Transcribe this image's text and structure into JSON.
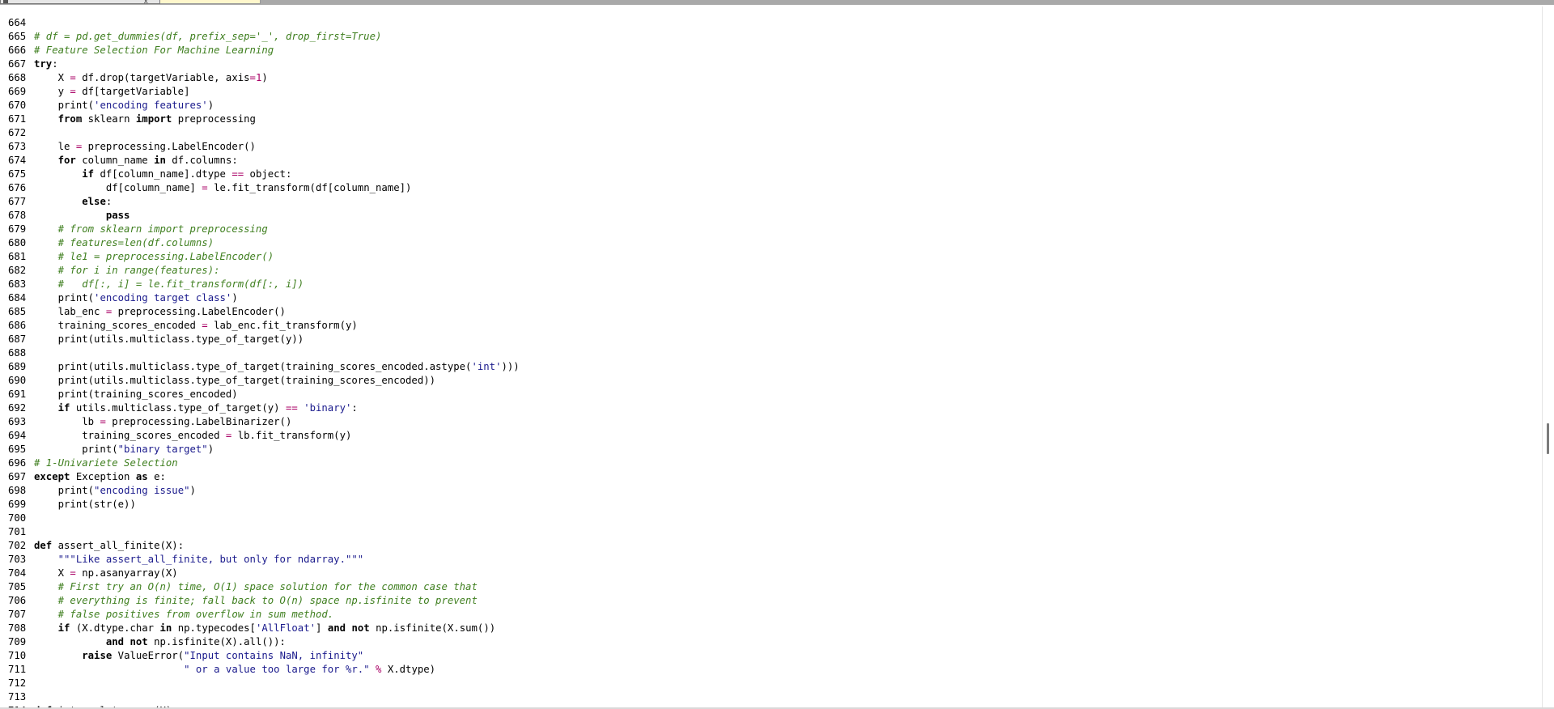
{
  "tabs": [
    {
      "label": "",
      "close": "x",
      "active": false
    },
    {
      "label": "",
      "close": "",
      "active": true
    }
  ],
  "scrollbar": {
    "position": 0.62
  },
  "colors": {
    "comment": "#3f7f1f",
    "string": "#1a1a8c",
    "operator": "#aa0066",
    "keyword": "#000000",
    "background": "#ffffff"
  },
  "editor": {
    "lines": [
      {
        "n": "664",
        "t": []
      },
      {
        "n": "665",
        "t": [
          [
            "c",
            "# df = pd.get_dummies(df, prefix_sep='_', drop_first=True)"
          ]
        ]
      },
      {
        "n": "666",
        "t": [
          [
            "c",
            "# Feature Selection For Machine Learning"
          ]
        ]
      },
      {
        "n": "667",
        "t": [
          [
            "k",
            "try"
          ],
          [
            "t",
            ":"
          ]
        ]
      },
      {
        "n": "668",
        "t": [
          [
            "t",
            "    X "
          ],
          [
            "o",
            "="
          ],
          [
            "t",
            " df.drop(targetVariable, axis"
          ],
          [
            "o",
            "="
          ],
          [
            "o",
            "1"
          ],
          [
            "t",
            ")"
          ]
        ]
      },
      {
        "n": "669",
        "t": [
          [
            "t",
            "    y "
          ],
          [
            "o",
            "="
          ],
          [
            "t",
            " df[targetVariable]"
          ]
        ]
      },
      {
        "n": "670",
        "t": [
          [
            "t",
            "    print("
          ],
          [
            "s",
            "'encoding features'"
          ],
          [
            "t",
            ")"
          ]
        ]
      },
      {
        "n": "671",
        "t": [
          [
            "t",
            "    "
          ],
          [
            "k",
            "from"
          ],
          [
            "t",
            " sklearn "
          ],
          [
            "k",
            "import"
          ],
          [
            "t",
            " preprocessing"
          ]
        ]
      },
      {
        "n": "672",
        "t": []
      },
      {
        "n": "673",
        "t": [
          [
            "t",
            "    le "
          ],
          [
            "o",
            "="
          ],
          [
            "t",
            " preprocessing.LabelEncoder()"
          ]
        ]
      },
      {
        "n": "674",
        "t": [
          [
            "t",
            "    "
          ],
          [
            "k",
            "for"
          ],
          [
            "t",
            " column_name "
          ],
          [
            "k",
            "in"
          ],
          [
            "t",
            " df.columns:"
          ]
        ]
      },
      {
        "n": "675",
        "t": [
          [
            "t",
            "        "
          ],
          [
            "k",
            "if"
          ],
          [
            "t",
            " df[column_name].dtype "
          ],
          [
            "o",
            "=="
          ],
          [
            "t",
            " object:"
          ]
        ]
      },
      {
        "n": "676",
        "t": [
          [
            "t",
            "            df[column_name] "
          ],
          [
            "o",
            "="
          ],
          [
            "t",
            " le.fit_transform(df[column_name])"
          ]
        ]
      },
      {
        "n": "677",
        "t": [
          [
            "t",
            "        "
          ],
          [
            "k",
            "else"
          ],
          [
            "t",
            ":"
          ]
        ]
      },
      {
        "n": "678",
        "t": [
          [
            "t",
            "            "
          ],
          [
            "k",
            "pass"
          ]
        ]
      },
      {
        "n": "679",
        "t": [
          [
            "t",
            "    "
          ],
          [
            "c",
            "# from sklearn import preprocessing"
          ]
        ]
      },
      {
        "n": "680",
        "t": [
          [
            "t",
            "    "
          ],
          [
            "c",
            "# features=len(df.columns)"
          ]
        ]
      },
      {
        "n": "681",
        "t": [
          [
            "t",
            "    "
          ],
          [
            "c",
            "# le1 = preprocessing.LabelEncoder()"
          ]
        ]
      },
      {
        "n": "682",
        "t": [
          [
            "t",
            "    "
          ],
          [
            "c",
            "# for i in range(features):"
          ]
        ]
      },
      {
        "n": "683",
        "t": [
          [
            "t",
            "    "
          ],
          [
            "c",
            "#   df[:, i] = le.fit_transform(df[:, i])"
          ]
        ]
      },
      {
        "n": "684",
        "t": [
          [
            "t",
            "    print("
          ],
          [
            "s",
            "'encoding target class'"
          ],
          [
            "t",
            ")"
          ]
        ]
      },
      {
        "n": "685",
        "t": [
          [
            "t",
            "    lab_enc "
          ],
          [
            "o",
            "="
          ],
          [
            "t",
            " preprocessing.LabelEncoder()"
          ]
        ]
      },
      {
        "n": "686",
        "t": [
          [
            "t",
            "    training_scores_encoded "
          ],
          [
            "o",
            "="
          ],
          [
            "t",
            " lab_enc.fit_transform(y)"
          ]
        ]
      },
      {
        "n": "687",
        "t": [
          [
            "t",
            "    print(utils.multiclass.type_of_target(y))"
          ]
        ]
      },
      {
        "n": "688",
        "t": []
      },
      {
        "n": "689",
        "t": [
          [
            "t",
            "    print(utils.multiclass.type_of_target(training_scores_encoded.astype("
          ],
          [
            "s",
            "'int'"
          ],
          [
            "t",
            ")))"
          ]
        ]
      },
      {
        "n": "690",
        "t": [
          [
            "t",
            "    print(utils.multiclass.type_of_target(training_scores_encoded))"
          ]
        ]
      },
      {
        "n": "691",
        "t": [
          [
            "t",
            "    print(training_scores_encoded)"
          ]
        ]
      },
      {
        "n": "692",
        "t": [
          [
            "t",
            "    "
          ],
          [
            "k",
            "if"
          ],
          [
            "t",
            " utils.multiclass.type_of_target(y) "
          ],
          [
            "o",
            "=="
          ],
          [
            "t",
            " "
          ],
          [
            "s",
            "'binary'"
          ],
          [
            "t",
            ":"
          ]
        ]
      },
      {
        "n": "693",
        "t": [
          [
            "t",
            "        lb "
          ],
          [
            "o",
            "="
          ],
          [
            "t",
            " preprocessing.LabelBinarizer()"
          ]
        ]
      },
      {
        "n": "694",
        "t": [
          [
            "t",
            "        training_scores_encoded "
          ],
          [
            "o",
            "="
          ],
          [
            "t",
            " lb.fit_transform(y)"
          ]
        ]
      },
      {
        "n": "695",
        "t": [
          [
            "t",
            "        print("
          ],
          [
            "s",
            "\"binary target\""
          ],
          [
            "t",
            ")"
          ]
        ]
      },
      {
        "n": "696",
        "t": [
          [
            "c",
            "# 1-Univariete Selection"
          ]
        ]
      },
      {
        "n": "697",
        "t": [
          [
            "k",
            "except"
          ],
          [
            "t",
            " Exception "
          ],
          [
            "k",
            "as"
          ],
          [
            "t",
            " e:"
          ]
        ]
      },
      {
        "n": "698",
        "t": [
          [
            "t",
            "    print("
          ],
          [
            "s",
            "\"encoding issue\""
          ],
          [
            "t",
            ")"
          ]
        ]
      },
      {
        "n": "699",
        "t": [
          [
            "t",
            "    print(str(e))"
          ]
        ]
      },
      {
        "n": "700",
        "t": []
      },
      {
        "n": "701",
        "t": []
      },
      {
        "n": "702",
        "t": [
          [
            "k",
            "def"
          ],
          [
            "t",
            " assert_all_finite(X):"
          ]
        ]
      },
      {
        "n": "703",
        "t": [
          [
            "t",
            "    "
          ],
          [
            "s",
            "\"\"\"Like assert_all_finite, but only for ndarray.\"\"\""
          ]
        ]
      },
      {
        "n": "704",
        "t": [
          [
            "t",
            "    X "
          ],
          [
            "o",
            "="
          ],
          [
            "t",
            " np.asanyarray(X)"
          ]
        ]
      },
      {
        "n": "705",
        "t": [
          [
            "t",
            "    "
          ],
          [
            "c",
            "# First try an O(n) time, O(1) space solution for the common case that"
          ]
        ]
      },
      {
        "n": "706",
        "t": [
          [
            "t",
            "    "
          ],
          [
            "c",
            "# everything is finite; fall back to O(n) space np.isfinite to prevent"
          ]
        ]
      },
      {
        "n": "707",
        "t": [
          [
            "t",
            "    "
          ],
          [
            "c",
            "# false positives from overflow in sum method."
          ]
        ]
      },
      {
        "n": "708",
        "t": [
          [
            "t",
            "    "
          ],
          [
            "k",
            "if"
          ],
          [
            "t",
            " (X.dtype.char "
          ],
          [
            "k",
            "in"
          ],
          [
            "t",
            " np.typecodes["
          ],
          [
            "s",
            "'AllFloat'"
          ],
          [
            "t",
            "] "
          ],
          [
            "k",
            "and"
          ],
          [
            "t",
            " "
          ],
          [
            "k",
            "not"
          ],
          [
            "t",
            " np.isfinite(X.sum())"
          ]
        ]
      },
      {
        "n": "709",
        "t": [
          [
            "t",
            "            "
          ],
          [
            "k",
            "and"
          ],
          [
            "t",
            " "
          ],
          [
            "k",
            "not"
          ],
          [
            "t",
            " np.isfinite(X).all()):"
          ]
        ]
      },
      {
        "n": "710",
        "t": [
          [
            "t",
            "        "
          ],
          [
            "k",
            "raise"
          ],
          [
            "t",
            " ValueError("
          ],
          [
            "s",
            "\"Input contains NaN, infinity\""
          ]
        ]
      },
      {
        "n": "711",
        "t": [
          [
            "t",
            "                         "
          ],
          [
            "s",
            "\" or a value too large for %r.\""
          ],
          [
            "t",
            " "
          ],
          [
            "o",
            "%"
          ],
          [
            "t",
            " X.dtype)"
          ]
        ]
      },
      {
        "n": "712",
        "t": []
      },
      {
        "n": "713",
        "t": []
      },
      {
        "n": "714",
        "t": [
          [
            "k",
            "def"
          ],
          [
            "t",
            " interpolate_nans(X):"
          ]
        ]
      }
    ]
  }
}
